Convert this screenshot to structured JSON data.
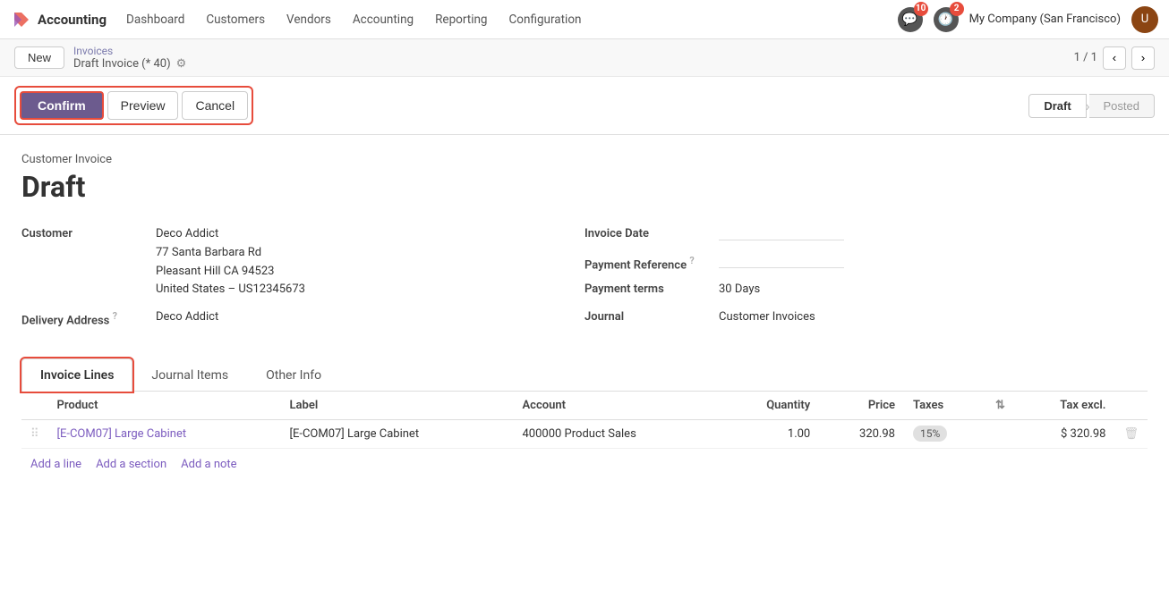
{
  "app": {
    "name": "Accounting",
    "logo_unicode": "✕"
  },
  "topnav": {
    "items": [
      "Dashboard",
      "Customers",
      "Vendors",
      "Accounting",
      "Reporting",
      "Configuration"
    ],
    "notifications_count": "10",
    "alerts_count": "2",
    "company": "My Company (San Francisco)",
    "avatar_label": "U"
  },
  "breadcrumb": {
    "new_label": "New",
    "parent_label": "Invoices",
    "current_label": "Draft Invoice (* 40)",
    "gear_icon": "⚙",
    "pagination": "1 / 1"
  },
  "actions": {
    "confirm_label": "Confirm",
    "preview_label": "Preview",
    "cancel_label": "Cancel",
    "status_draft": "Draft",
    "status_posted": "Posted"
  },
  "invoice": {
    "type_label": "Customer Invoice",
    "status": "Draft",
    "customer_label": "Customer",
    "customer_name": "Deco Addict",
    "customer_address_line1": "77 Santa Barbara Rd",
    "customer_address_line2": "Pleasant Hill CA 94523",
    "customer_address_line3": "United States – US12345673",
    "delivery_address_label": "Delivery Address",
    "delivery_address_tooltip": "?",
    "delivery_address_value": "Deco Addict",
    "invoice_date_label": "Invoice Date",
    "invoice_date_value": "",
    "payment_ref_label": "Payment Reference",
    "payment_ref_tooltip": "?",
    "payment_ref_value": "",
    "payment_terms_label": "Payment terms",
    "payment_terms_value": "30 Days",
    "journal_label": "Journal",
    "journal_value": "Customer Invoices"
  },
  "tabs": [
    {
      "label": "Invoice Lines",
      "active": true
    },
    {
      "label": "Journal Items",
      "active": false
    },
    {
      "label": "Other Info",
      "active": false
    }
  ],
  "table": {
    "headers": [
      "",
      "Product",
      "Label",
      "Account",
      "Quantity",
      "Price",
      "Taxes",
      "",
      "Tax excl.",
      ""
    ],
    "rows": [
      {
        "drag": "⠿",
        "product": "[E-COM07] Large Cabinet",
        "label": "[E-COM07] Large Cabinet",
        "account": "400000 Product Sales",
        "quantity": "1.00",
        "price": "320.98",
        "tax": "15%",
        "tax_excl": "$ 320.98",
        "delete_icon": "🗑"
      }
    ]
  },
  "add_links": {
    "add_line": "Add a line",
    "add_section": "Add a section",
    "add_note": "Add a note"
  }
}
